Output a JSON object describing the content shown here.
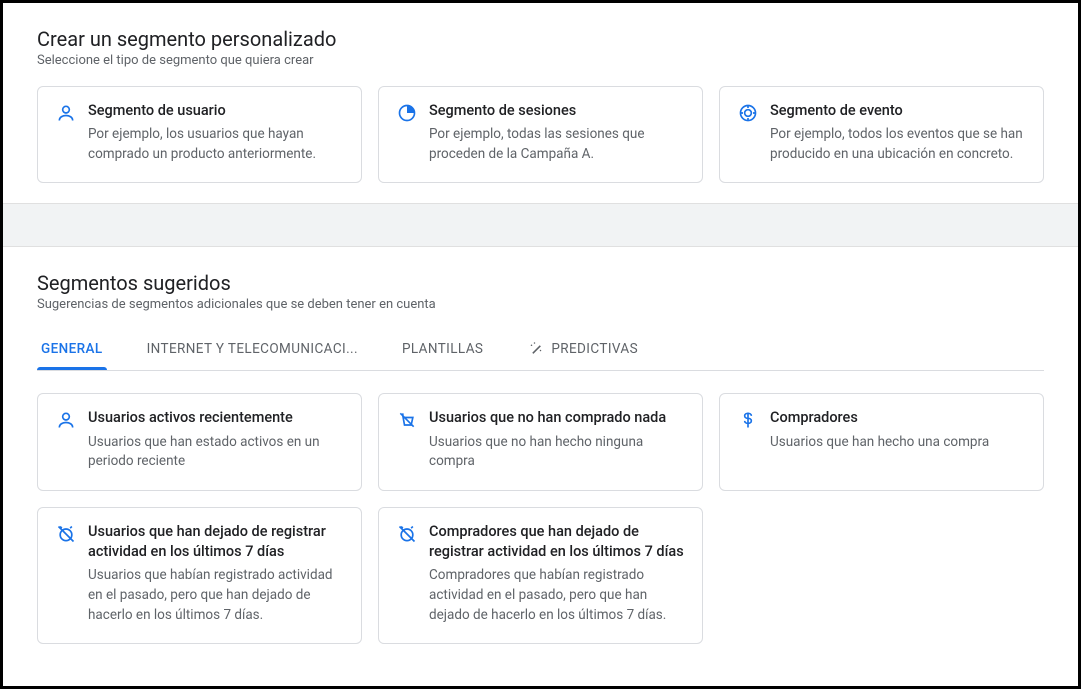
{
  "custom": {
    "title": "Crear un segmento personalizado",
    "subtitle": "Seleccione el tipo de segmento que quiera crear",
    "cards": [
      {
        "icon": "person",
        "title": "Segmento de usuario",
        "desc": "Por ejemplo, los usuarios que hayan comprado un producto anteriormente."
      },
      {
        "icon": "session",
        "title": "Segmento de sesiones",
        "desc": "Por ejemplo, todas las sesiones que proceden de la Campaña A."
      },
      {
        "icon": "event",
        "title": "Segmento de evento",
        "desc": "Por ejemplo, todos los eventos que se han producido en una ubicación en concreto."
      }
    ]
  },
  "suggested": {
    "title": "Segmentos sugeridos",
    "subtitle": "Sugerencias de segmentos adicionales que se deben tener en cuenta",
    "tabs": [
      {
        "label": "GENERAL",
        "active": true
      },
      {
        "label": "INTERNET Y TELECOMUNICACI...",
        "active": false
      },
      {
        "label": "PLANTILLAS",
        "active": false
      },
      {
        "label": "PREDICTIVAS",
        "active": false,
        "icon": "wand"
      }
    ],
    "cards": [
      {
        "icon": "person",
        "title": "Usuarios activos recientemente",
        "desc": "Usuarios que han estado activos en un periodo reciente"
      },
      {
        "icon": "no-buy",
        "title": "Usuarios que no han comprado nada",
        "desc": "Usuarios que no han hecho ninguna compra"
      },
      {
        "icon": "dollar",
        "title": "Compradores",
        "desc": "Usuarios que han hecho una compra"
      },
      {
        "icon": "alarm-off",
        "title": "Usuarios que han dejado de registrar actividad en los últimos 7 días",
        "desc": "Usuarios que habían registrado actividad en el pasado, pero que han dejado de hacerlo en los últimos 7 días."
      },
      {
        "icon": "alarm-off",
        "title": "Compradores que han dejado de registrar actividad en los últimos 7 días",
        "desc": "Compradores que habían registrado actividad en el pasado, pero que han dejado de hacerlo en los últimos 7 días."
      }
    ]
  }
}
